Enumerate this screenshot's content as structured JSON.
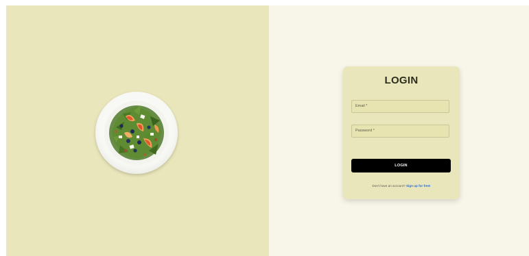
{
  "hero": {
    "image_alt_icon": "salad-plate"
  },
  "login": {
    "title": "LOGIN",
    "email_placeholder": "Email *",
    "password_placeholder": "Password *",
    "button_label": "LOGIN",
    "signup_prompt": "Don't have an account?",
    "signup_link": "Sign up for free!"
  },
  "colors": {
    "left_bg": "#e9e6bb",
    "right_bg": "#f8f6e8",
    "card_bg": "#e9e6bb",
    "button_bg": "#000000",
    "link": "#2a6bd8"
  }
}
